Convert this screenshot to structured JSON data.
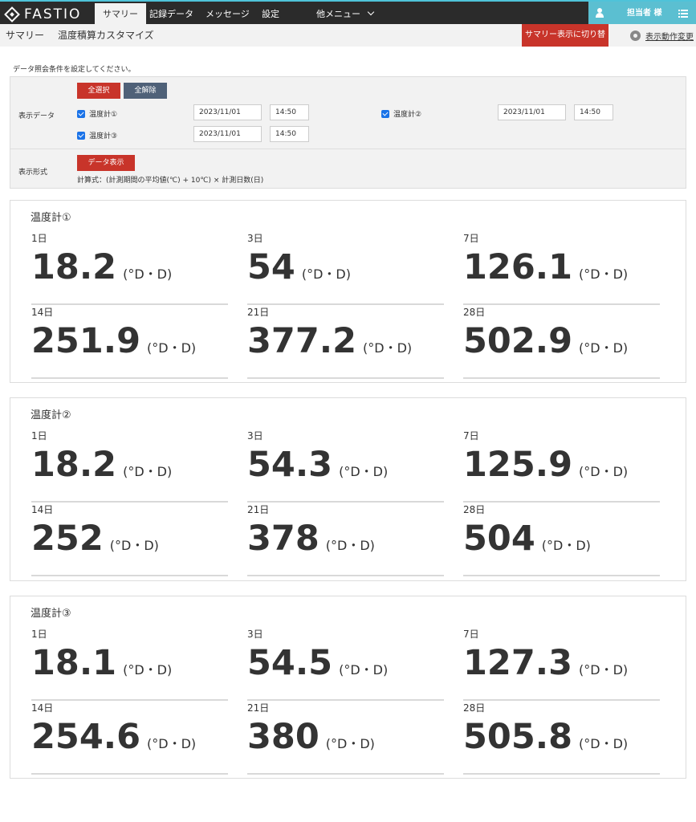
{
  "header": {
    "brand": "FASTIO",
    "tabs": [
      {
        "label": "サマリー"
      },
      {
        "label": "記録データ"
      },
      {
        "label": "メッセージ"
      },
      {
        "label": "設定"
      },
      {
        "label": "他メニュー"
      }
    ],
    "user": "担当者 様"
  },
  "subheader": {
    "breadcrumb": [
      "サマリー",
      "温度積算カスタマイズ"
    ],
    "switch_button": "サマリー表示に切り替え",
    "settings_link": "表示動作変更"
  },
  "conditions": {
    "instruction": "データ照会条件を設定してください。",
    "display_data_label": "表示データ",
    "select_all": "全選択",
    "deselect_all": "全解除",
    "sensors": [
      {
        "name": "温度計①",
        "checked": true,
        "date": "2023/11/01",
        "time": "14:50"
      },
      {
        "name": "温度計②",
        "checked": true,
        "date": "2023/11/01",
        "time": "14:50"
      },
      {
        "name": "温度計③",
        "checked": true,
        "date": "2023/11/01",
        "time": "14:50"
      }
    ],
    "format_label": "表示形式",
    "show_data": "データ表示",
    "formula": "計算式：(計測期間の平均値(℃) + 10℃) × 計測日数(日)"
  },
  "unit": "(°D・D)",
  "cards": [
    {
      "title": "温度計①",
      "metrics": [
        {
          "label": "1日",
          "value": "18.2"
        },
        {
          "label": "3日",
          "value": "54"
        },
        {
          "label": "7日",
          "value": "126.1"
        },
        {
          "label": "14日",
          "value": "251.9"
        },
        {
          "label": "21日",
          "value": "377.2"
        },
        {
          "label": "28日",
          "value": "502.9"
        }
      ]
    },
    {
      "title": "温度計②",
      "metrics": [
        {
          "label": "1日",
          "value": "18.2"
        },
        {
          "label": "3日",
          "value": "54.3"
        },
        {
          "label": "7日",
          "value": "125.9"
        },
        {
          "label": "14日",
          "value": "252"
        },
        {
          "label": "21日",
          "value": "378"
        },
        {
          "label": "28日",
          "value": "504"
        }
      ]
    },
    {
      "title": "温度計③",
      "metrics": [
        {
          "label": "1日",
          "value": "18.1"
        },
        {
          "label": "3日",
          "value": "54.5"
        },
        {
          "label": "7日",
          "value": "127.3"
        },
        {
          "label": "14日",
          "value": "254.6"
        },
        {
          "label": "21日",
          "value": "380"
        },
        {
          "label": "28日",
          "value": "505.8"
        }
      ]
    }
  ]
}
